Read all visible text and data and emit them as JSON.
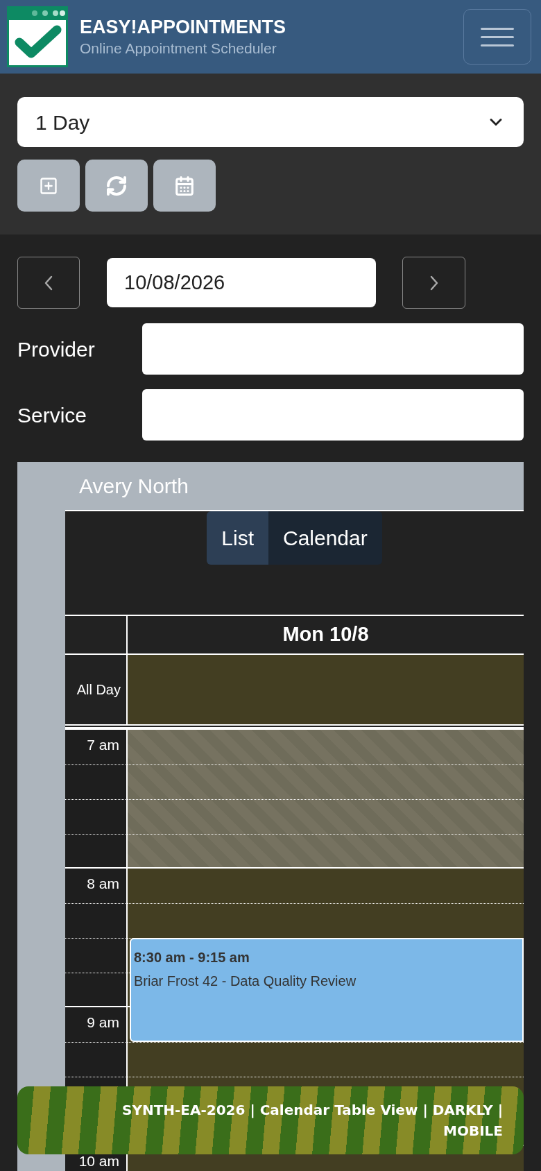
{
  "header": {
    "title": "EASY!APPOINTMENTS",
    "subtitle": "Online Appointment Scheduler"
  },
  "view_select": {
    "value": "1 Day"
  },
  "date_nav": {
    "date": "10/08/2026"
  },
  "filters": [
    {
      "label": "Provider"
    },
    {
      "label": "Service"
    }
  ],
  "calendar": {
    "provider": "Avery North",
    "view_tabs": [
      {
        "label": "List",
        "selected": true
      },
      {
        "label": "Calendar",
        "selected": false
      }
    ],
    "day_header": "Mon 10/8",
    "all_day_label": "All Day",
    "hours": [
      {
        "label": "7 am",
        "unavailable": true
      },
      {
        "label": "8 am",
        "unavailable": false,
        "events": [
          {
            "time": "8:30 am - 9:15 am",
            "title": "Briar Frost 42 - Data Quality Review",
            "color": "#7cb8e8"
          }
        ]
      },
      {
        "label": "9 am",
        "unavailable": false
      },
      {
        "label": "10 am",
        "unavailable": false
      }
    ]
  },
  "banner": {
    "lines": [
      "SYNTH-EA-2026 | Calendar Table View | DARKLY |",
      "MOBILE"
    ]
  }
}
